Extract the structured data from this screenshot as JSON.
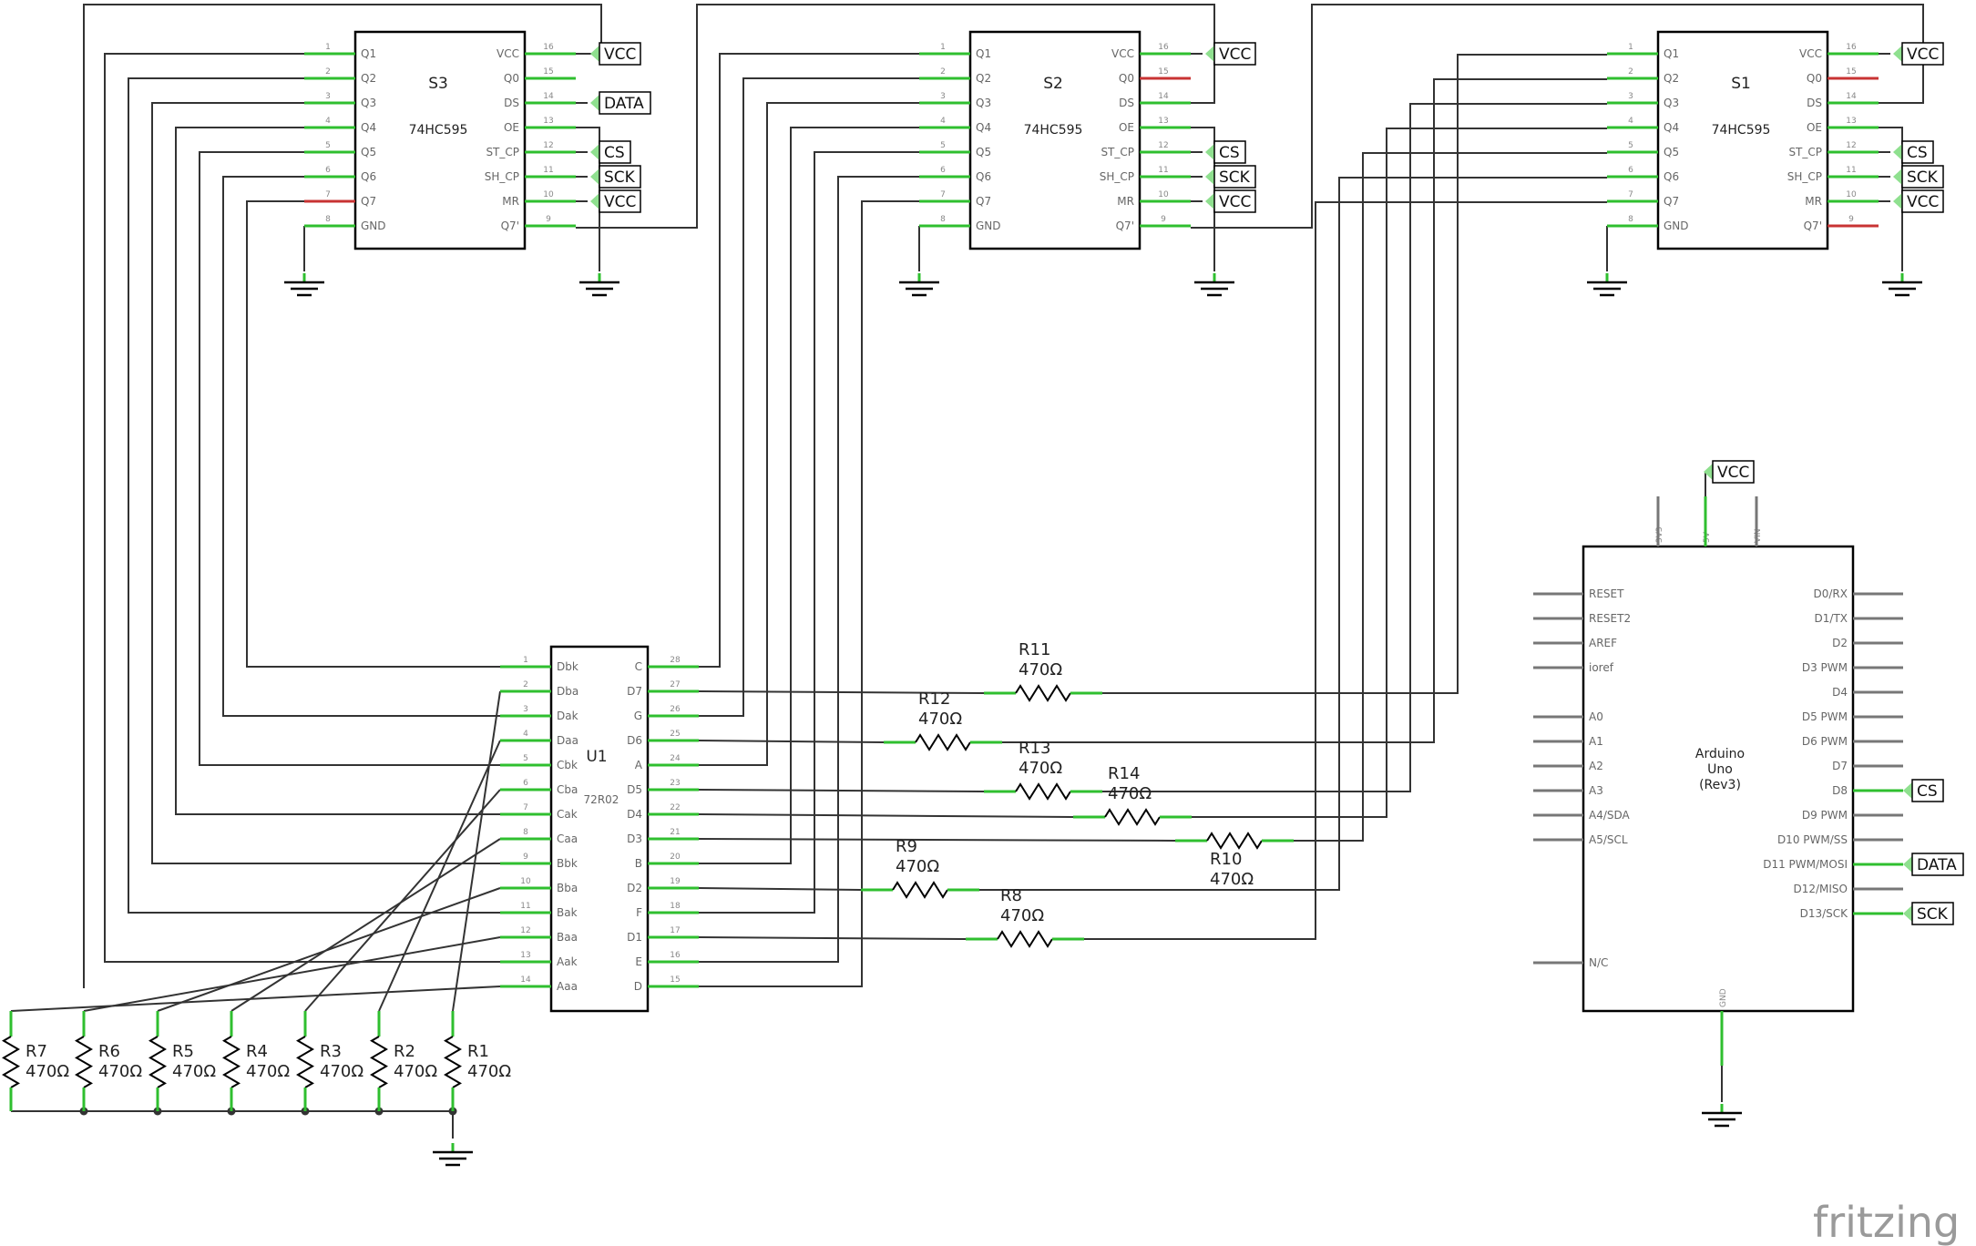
{
  "app": {
    "watermark": "fritzing"
  },
  "colors": {
    "wire": "#333333",
    "pin": "#2fbf2f",
    "pin_unconnected": "#c83333",
    "body": "#000000",
    "label_bg": "#8fe08f"
  },
  "shift_registers": [
    {
      "ref": "S3",
      "chip": "74HC595",
      "left_pins": [
        {
          "num": "1",
          "name": "Q1"
        },
        {
          "num": "2",
          "name": "Q2"
        },
        {
          "num": "3",
          "name": "Q3"
        },
        {
          "num": "4",
          "name": "Q4"
        },
        {
          "num": "5",
          "name": "Q5"
        },
        {
          "num": "6",
          "name": "Q6"
        },
        {
          "num": "7",
          "name": "Q7"
        },
        {
          "num": "8",
          "name": "GND"
        }
      ],
      "right_pins": [
        {
          "num": "16",
          "name": "VCC"
        },
        {
          "num": "15",
          "name": "Q0"
        },
        {
          "num": "14",
          "name": "DS"
        },
        {
          "num": "13",
          "name": "OE"
        },
        {
          "num": "12",
          "name": "ST_CP"
        },
        {
          "num": "11",
          "name": "SH_CP"
        },
        {
          "num": "10",
          "name": "MR"
        },
        {
          "num": "9",
          "name": "Q7'"
        }
      ],
      "nets": [
        "VCC",
        "DATA",
        "CS",
        "SCK",
        "VCC"
      ]
    },
    {
      "ref": "S2",
      "chip": "74HC595",
      "left_pins": [
        {
          "num": "1",
          "name": "Q1"
        },
        {
          "num": "2",
          "name": "Q2"
        },
        {
          "num": "3",
          "name": "Q3"
        },
        {
          "num": "4",
          "name": "Q4"
        },
        {
          "num": "5",
          "name": "Q5"
        },
        {
          "num": "6",
          "name": "Q6"
        },
        {
          "num": "7",
          "name": "Q7"
        },
        {
          "num": "8",
          "name": "GND"
        }
      ],
      "right_pins": [
        {
          "num": "16",
          "name": "VCC"
        },
        {
          "num": "15",
          "name": "Q0"
        },
        {
          "num": "14",
          "name": "DS"
        },
        {
          "num": "13",
          "name": "OE"
        },
        {
          "num": "12",
          "name": "ST_CP"
        },
        {
          "num": "11",
          "name": "SH_CP"
        },
        {
          "num": "10",
          "name": "MR"
        },
        {
          "num": "9",
          "name": "Q7'"
        }
      ],
      "nets": [
        "VCC",
        "CS",
        "SCK",
        "VCC"
      ]
    },
    {
      "ref": "S1",
      "chip": "74HC595",
      "left_pins": [
        {
          "num": "1",
          "name": "Q1"
        },
        {
          "num": "2",
          "name": "Q2"
        },
        {
          "num": "3",
          "name": "Q3"
        },
        {
          "num": "4",
          "name": "Q4"
        },
        {
          "num": "5",
          "name": "Q5"
        },
        {
          "num": "6",
          "name": "Q6"
        },
        {
          "num": "7",
          "name": "Q7"
        },
        {
          "num": "8",
          "name": "GND"
        }
      ],
      "right_pins": [
        {
          "num": "16",
          "name": "VCC"
        },
        {
          "num": "15",
          "name": "Q0"
        },
        {
          "num": "14",
          "name": "DS"
        },
        {
          "num": "13",
          "name": "OE"
        },
        {
          "num": "12",
          "name": "ST_CP"
        },
        {
          "num": "11",
          "name": "SH_CP"
        },
        {
          "num": "10",
          "name": "MR"
        },
        {
          "num": "9",
          "name": "Q7'"
        }
      ],
      "nets": [
        "VCC",
        "CS",
        "SCK",
        "VCC"
      ]
    }
  ],
  "display": {
    "ref": "U1",
    "chip": "72R02",
    "left_pins": [
      {
        "num": "1",
        "name": "Dbk"
      },
      {
        "num": "2",
        "name": "Dba"
      },
      {
        "num": "3",
        "name": "Dak"
      },
      {
        "num": "4",
        "name": "Daa"
      },
      {
        "num": "5",
        "name": "Cbk"
      },
      {
        "num": "6",
        "name": "Cba"
      },
      {
        "num": "7",
        "name": "Cak"
      },
      {
        "num": "8",
        "name": "Caa"
      },
      {
        "num": "9",
        "name": "Bbk"
      },
      {
        "num": "10",
        "name": "Bba"
      },
      {
        "num": "11",
        "name": "Bak"
      },
      {
        "num": "12",
        "name": "Baa"
      },
      {
        "num": "13",
        "name": "Aak"
      },
      {
        "num": "14",
        "name": "Aaa"
      }
    ],
    "right_pins": [
      {
        "num": "28",
        "name": "C"
      },
      {
        "num": "27",
        "name": "D7"
      },
      {
        "num": "26",
        "name": "G"
      },
      {
        "num": "25",
        "name": "D6"
      },
      {
        "num": "24",
        "name": "A"
      },
      {
        "num": "23",
        "name": "D5"
      },
      {
        "num": "22",
        "name": "D4"
      },
      {
        "num": "21",
        "name": "D3"
      },
      {
        "num": "20",
        "name": "B"
      },
      {
        "num": "19",
        "name": "D2"
      },
      {
        "num": "18",
        "name": "F"
      },
      {
        "num": "17",
        "name": "D1"
      },
      {
        "num": "16",
        "name": "E"
      },
      {
        "num": "15",
        "name": "D"
      }
    ]
  },
  "resistors_bottom": [
    {
      "ref": "R7",
      "value": "470Ω"
    },
    {
      "ref": "R6",
      "value": "470Ω"
    },
    {
      "ref": "R5",
      "value": "470Ω"
    },
    {
      "ref": "R4",
      "value": "470Ω"
    },
    {
      "ref": "R3",
      "value": "470Ω"
    },
    {
      "ref": "R2",
      "value": "470Ω"
    },
    {
      "ref": "R1",
      "value": "470Ω"
    }
  ],
  "resistors_mid": [
    {
      "ref": "R11",
      "value": "470Ω"
    },
    {
      "ref": "R12",
      "value": "470Ω"
    },
    {
      "ref": "R13",
      "value": "470Ω"
    },
    {
      "ref": "R14",
      "value": "470Ω"
    },
    {
      "ref": "R10",
      "value": "470Ω"
    },
    {
      "ref": "R9",
      "value": "470Ω"
    },
    {
      "ref": "R8",
      "value": "470Ω"
    }
  ],
  "arduino": {
    "title_lines": [
      "Arduino",
      "Uno",
      "(Rev3)"
    ],
    "top_pins": [
      "3V3",
      "5V",
      "VIN"
    ],
    "left_pins": [
      "RESET",
      "RESET2",
      "AREF",
      "ioref",
      "",
      "A0",
      "A1",
      "A2",
      "A3",
      "A4/SDA",
      "A5/SCL",
      "",
      "",
      "",
      "",
      "N/C"
    ],
    "right_pins": [
      "D0/RX",
      "D1/TX",
      "D2",
      "D3 PWM",
      "D4",
      "D5 PWM",
      "D6 PWM",
      "D7",
      "D8",
      "D9 PWM",
      "D10 PWM/SS",
      "D11 PWM/MOSI",
      "D12/MISO",
      "D13/SCK"
    ],
    "bottom_pin": "GND",
    "net_vcc": "VCC",
    "net_cs": "CS",
    "net_data": "DATA",
    "net_sck": "SCK"
  }
}
